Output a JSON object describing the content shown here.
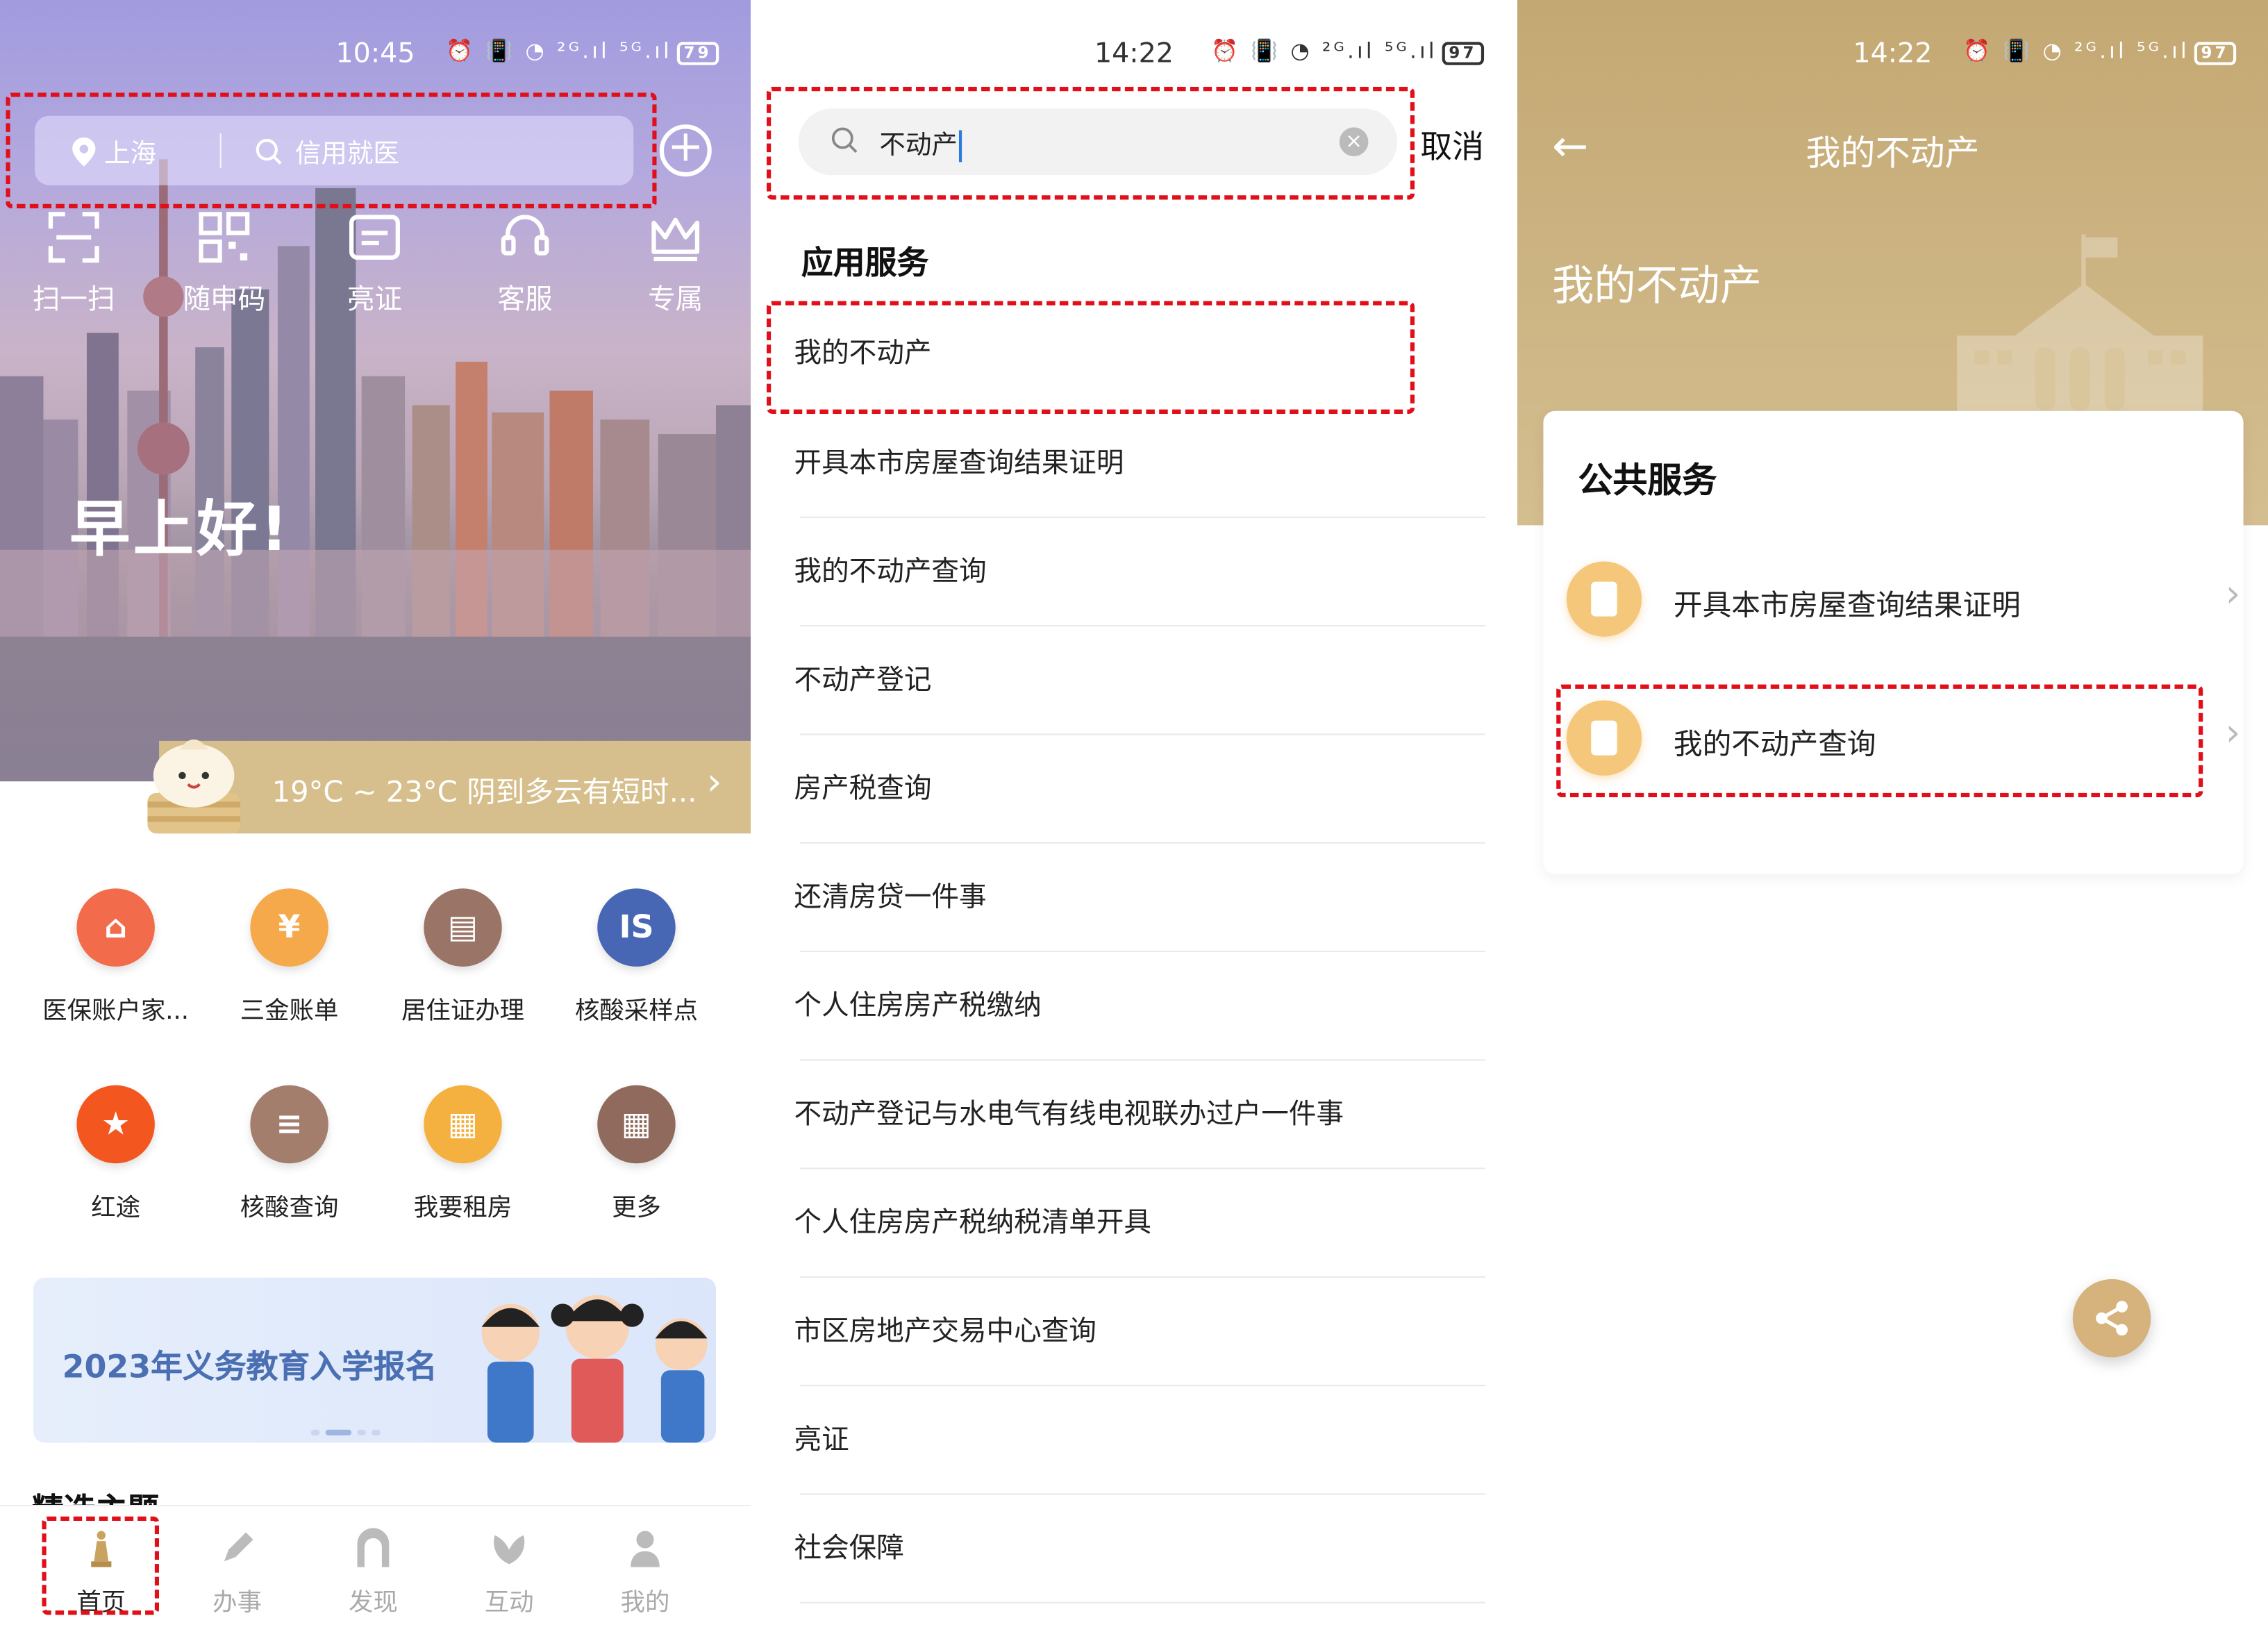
{
  "phone1": {
    "status": {
      "time": "10:45",
      "icons": "⏰ 📳 ◔ ²ᴳ.ıl ⁵ᴳ.ıl",
      "battery": "79"
    },
    "search": {
      "location": "上海",
      "placeholder": "信用就医"
    },
    "quick_actions": [
      "扫一扫",
      "随申码",
      "亮证",
      "客服",
      "专属"
    ],
    "greeting": "早上好!",
    "weather": "19°C ~ 23°C  阴到多云有短时...",
    "apps": [
      {
        "label": "医保账户家...",
        "color": "#f26b4b"
      },
      {
        "label": "三金账单",
        "color": "#f6a94a"
      },
      {
        "label": "居住证办理",
        "color": "#9a7466"
      },
      {
        "label": "核酸采样点",
        "color": "#4766b4"
      },
      {
        "label": "红途",
        "color": "#f3571f"
      },
      {
        "label": "核酸查询",
        "color": "#a37e6d"
      },
      {
        "label": "我要租房",
        "color": "#f5b13f"
      },
      {
        "label": "更多",
        "color": "#8f6a5d"
      }
    ],
    "banner": "2023年义务教育入学报名",
    "section_title": "精选主题",
    "tabs": [
      "首页",
      "办事",
      "发现",
      "互动",
      "我的"
    ]
  },
  "phone2": {
    "status": {
      "time": "14:22",
      "icons": "⏰ 📳 ◔ ²ᴳ.ıl ⁵ᴳ.ıl",
      "battery": "97"
    },
    "search_value": "不动产",
    "cancel": "取消",
    "section": "应用服务",
    "results": [
      "我的不动产",
      "开具本市房屋查询结果证明",
      "我的不动产查询",
      "不动产登记",
      "房产税查询",
      "还清房贷一件事",
      "个人住房房产税缴纳",
      "不动产登记与水电气有线电视联办过户一件事",
      "个人住房房产税纳税清单开具",
      "市区房地产交易中心查询",
      "亮证",
      "社会保障"
    ]
  },
  "phone3": {
    "status": {
      "time": "14:22",
      "icons": "⏰ 📳 ◔ ²ᴳ.ıl ⁵ᴳ.ıl",
      "battery": "97"
    },
    "nav_title": "我的不动产",
    "header_title": "我的不动产",
    "card_title": "公共服务",
    "items": [
      "开具本市房屋查询结果证明",
      "我的不动产查询"
    ]
  }
}
